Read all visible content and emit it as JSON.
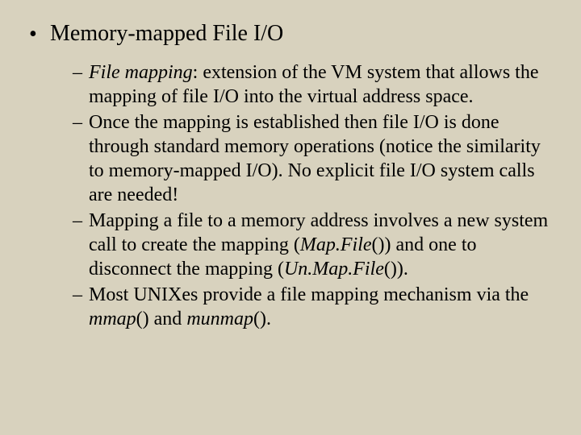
{
  "slide": {
    "heading": "Memory-mapped File I/O",
    "bullets": [
      {
        "lead_italic": "File mapping",
        "rest": ": extension of the VM system that allows the mapping of file I/O into the virtual address space."
      },
      {
        "plain": "Once the mapping is established then file I/O is done through standard memory operations (notice the similarity to memory-mapped I/O).  No explicit file I/O system calls are needed!"
      },
      {
        "pre1": "Mapping a file to a memory address involves a new system call to create the mapping (",
        "ital1": "Map.File",
        "mid1": "()) and one to disconnect the mapping (",
        "ital2": "Un.Map.File",
        "post1": "())."
      },
      {
        "pre1": "Most UNIXes provide a file mapping mechanism via the ",
        "ital1": "mmap",
        "mid1": "() and ",
        "ital2": "munmap",
        "post1": "()."
      }
    ]
  },
  "glyphs": {
    "disc": "•",
    "dash": "–"
  }
}
